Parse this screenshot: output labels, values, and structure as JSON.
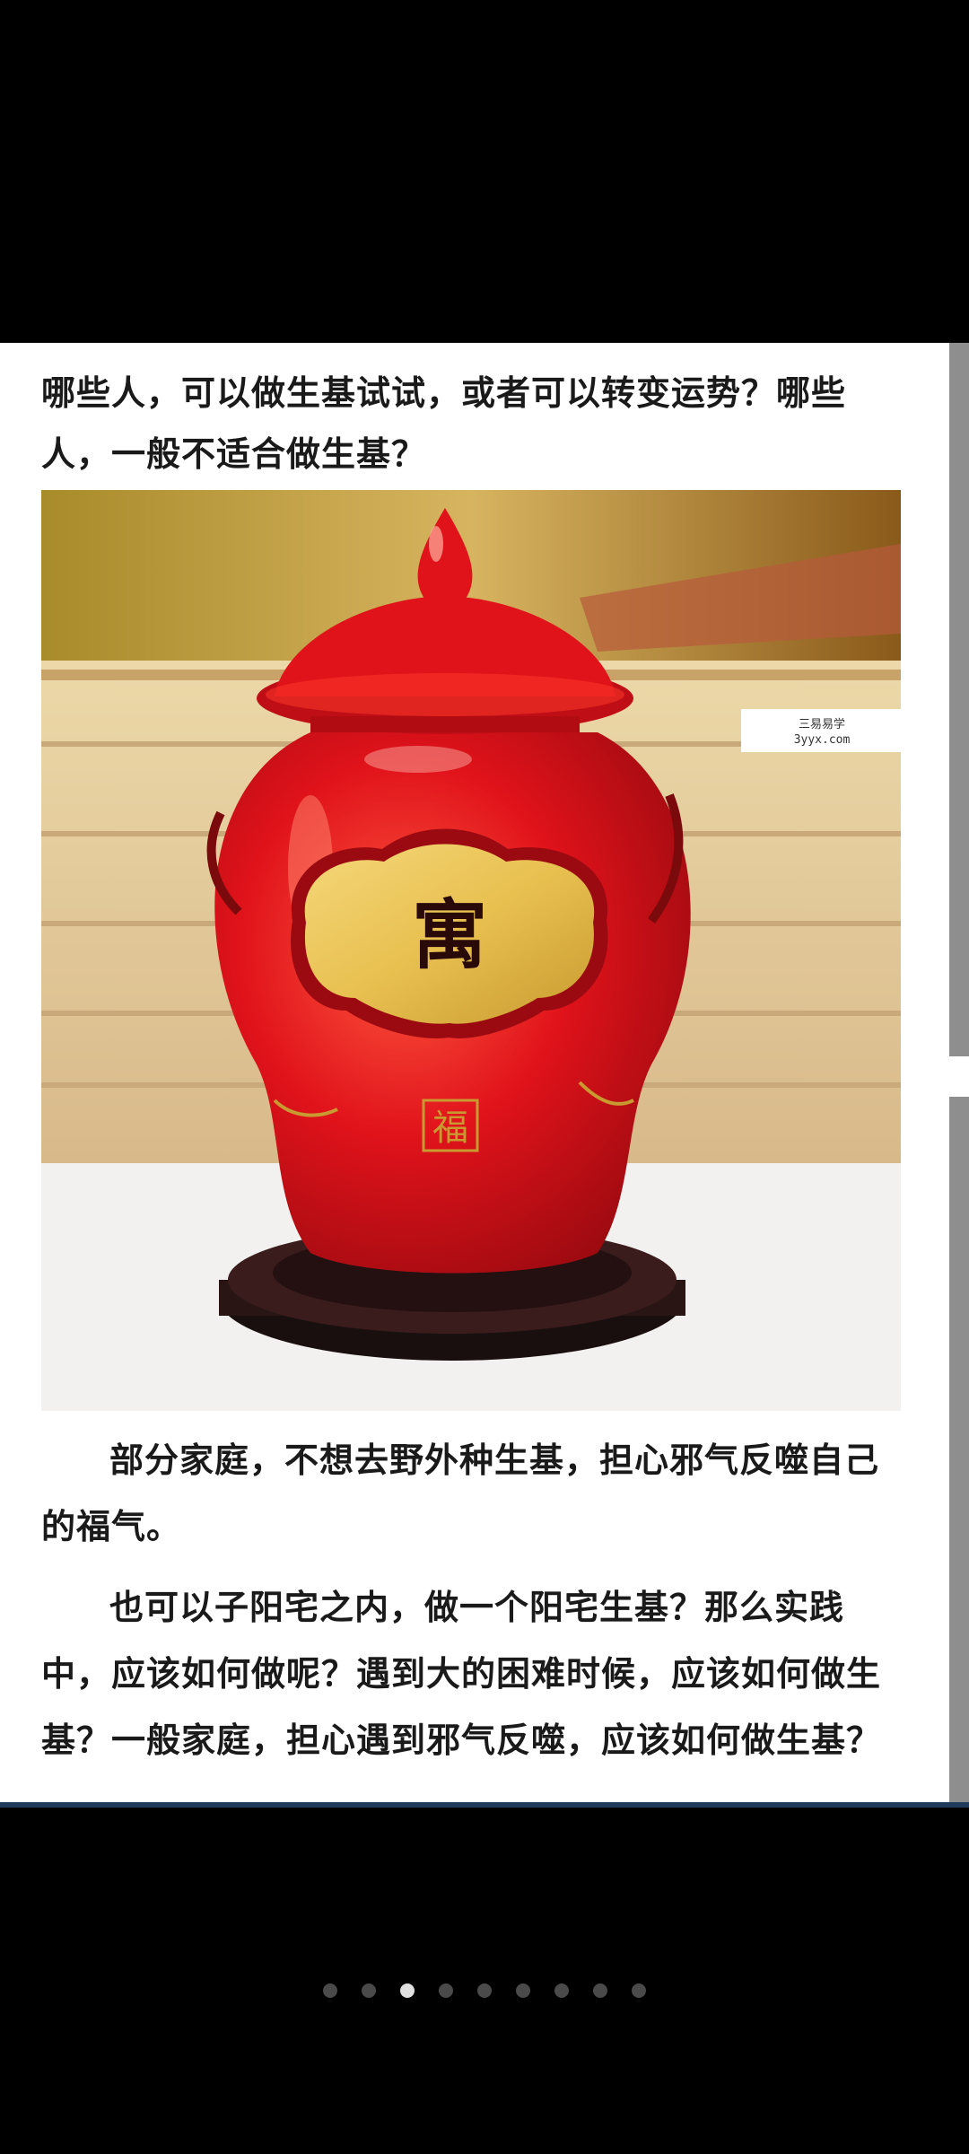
{
  "article": {
    "heading": "哪些人，可以做生基试试，或者可以转变运势？哪些人，一般不适合做生基？",
    "paragraphs": [
      "部分家庭，不想去野外种生基，担心邪气反噬自己的福气。",
      "也可以子阳宅之内，做一个阳宅生基？那么实践中，应该如何做呢？遇到大的困难时候，应该如何做生基？一般家庭，担心遇到邪气反噬，应该如何做生基？"
    ],
    "image": {
      "jar_character": "寓",
      "seal_character": "福"
    },
    "watermark": {
      "line1": "三易易学",
      "line2": "3yyx.com"
    }
  },
  "pager": {
    "count": 9,
    "active_index": 2
  },
  "colors": {
    "jar_red": "#e0121a",
    "gold": "#e8c050",
    "stand": "#1a0f0f"
  }
}
